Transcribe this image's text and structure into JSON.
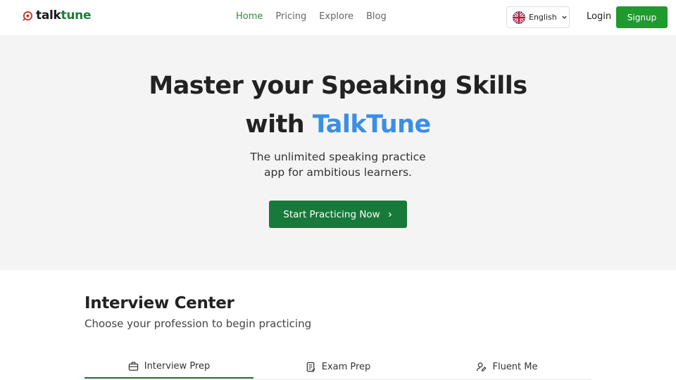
{
  "brand": {
    "name_part1": "talk",
    "name_part2": "tune",
    "accent_color": "#1a7f34"
  },
  "nav": {
    "items": [
      {
        "label": "Home",
        "active": true
      },
      {
        "label": "Pricing",
        "active": false
      },
      {
        "label": "Explore",
        "active": false
      },
      {
        "label": "Blog",
        "active": false
      }
    ]
  },
  "language": {
    "selected": "English",
    "icon": "uk-flag-icon"
  },
  "auth": {
    "login_label": "Login",
    "signup_label": "Signup"
  },
  "hero": {
    "title_line1": "Master your Speaking Skills",
    "title_line2_prefix": "with",
    "title_line2_accent": "TalkTune",
    "subtitle_line1": "The unlimited speaking practice",
    "subtitle_line2": "app for ambitious learners.",
    "cta_label": "Start Practicing Now",
    "accent_color": "#3a8ee6",
    "cta_color": "#177a3a"
  },
  "interview_center": {
    "title": "Interview Center",
    "subtitle": "Choose your profession to begin practicing",
    "tabs": [
      {
        "label": "Interview Prep",
        "icon": "briefcase-icon",
        "active": true
      },
      {
        "label": "Exam Prep",
        "icon": "document-icon",
        "active": false
      },
      {
        "label": "Fluent Me",
        "icon": "user-edit-icon",
        "active": false
      }
    ]
  }
}
